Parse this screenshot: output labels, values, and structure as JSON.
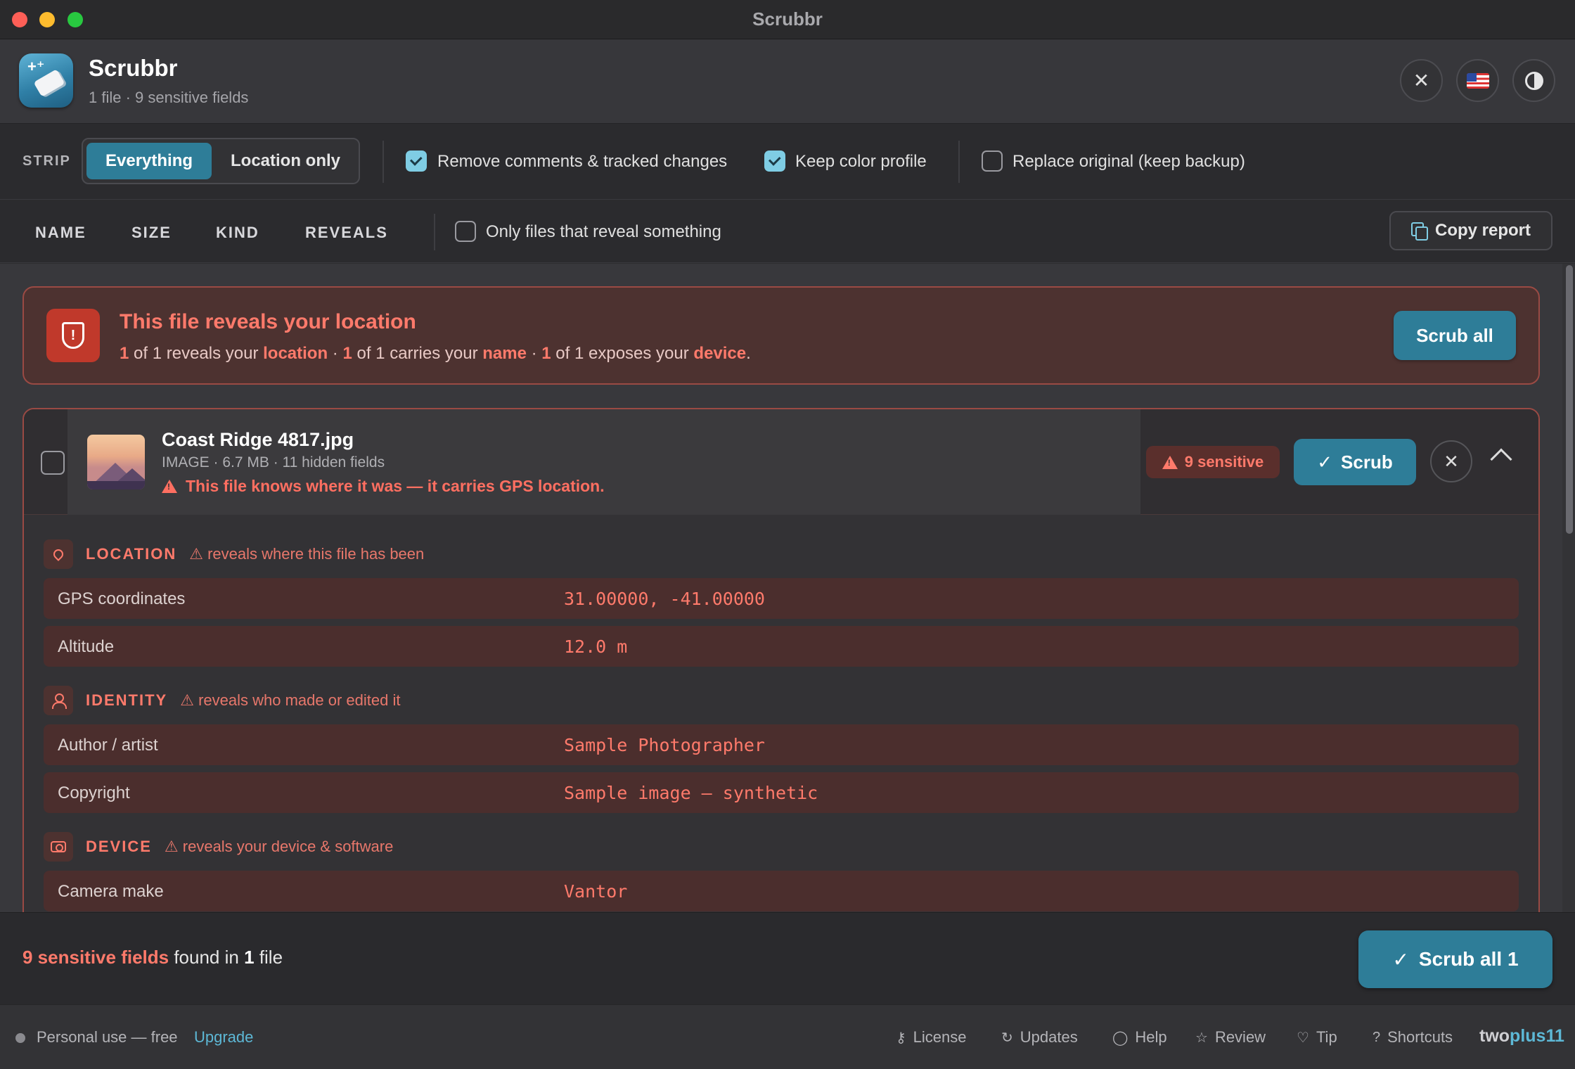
{
  "window": {
    "title": "Scrubbr"
  },
  "header": {
    "app_name": "Scrubbr",
    "subtitle": "1 file · 9 sensitive fields",
    "buttons": {
      "close": "close-icon",
      "language": "us-flag-icon",
      "theme": "contrast-icon"
    }
  },
  "strip": {
    "label": "STRIP",
    "modes": [
      "Everything",
      "Location only"
    ],
    "selected_mode": "Everything",
    "options": [
      {
        "label": "Remove comments & tracked changes",
        "checked": true
      },
      {
        "label": "Keep color profile",
        "checked": true
      },
      {
        "label": "Replace original (keep backup)",
        "checked": false
      }
    ]
  },
  "columns": {
    "headers": [
      "NAME",
      "SIZE",
      "KIND",
      "REVEALS"
    ],
    "filter_label": "Only files that reveal something",
    "filter_checked": false,
    "copy_report": "Copy report"
  },
  "alert": {
    "title": "This file reveals your location",
    "parts": {
      "n1": "1",
      "t1": " of 1 reveals your ",
      "k1": "location",
      "s1": " · ",
      "n2": "1",
      "t2": " of 1 carries your ",
      "k2": "name",
      "s2": " · ",
      "n3": "1",
      "t3": " of 1 exposes your ",
      "k3": "device",
      "end": "."
    },
    "button": "Scrub all"
  },
  "file": {
    "name": "Coast Ridge 4817.jpg",
    "meta": "IMAGE · 6.7 MB · 11 hidden fields",
    "warning": "This file knows where it was — it carries GPS location.",
    "badge": "9 sensitive",
    "scrub_button": "Scrub",
    "selected": false,
    "expanded": true
  },
  "sections": {
    "location": {
      "title": "LOCATION",
      "note": "reveals where this file has been",
      "fields": [
        {
          "label": "GPS coordinates",
          "value": "31.00000, -41.00000"
        },
        {
          "label": "Altitude",
          "value": "12.0 m"
        }
      ]
    },
    "identity": {
      "title": "IDENTITY",
      "note": "reveals who made or edited it",
      "fields": [
        {
          "label": "Author / artist",
          "value": "Sample Photographer"
        },
        {
          "label": "Copyright",
          "value": "Sample image — synthetic"
        }
      ]
    },
    "device": {
      "title": "DEVICE",
      "note": "reveals your device & software",
      "fields": [
        {
          "label": "Camera make",
          "value": "Vantor"
        }
      ]
    }
  },
  "summary": {
    "count_label": "9 sensitive fields",
    "mid": " found in ",
    "file_count": "1",
    "end": " file",
    "button": "Scrub all 1"
  },
  "footer": {
    "plan": "Personal use — free",
    "upgrade": "Upgrade",
    "links": [
      "License",
      "Updates",
      "Help",
      "Review",
      "Tip",
      "Shortcuts"
    ],
    "brand_a": "two",
    "brand_b": "plus11"
  },
  "colors": {
    "accent": "#2e7d98",
    "danger": "#ff7a6b",
    "danger_bg": "#4b2e2d",
    "check": "#7fcde4"
  }
}
